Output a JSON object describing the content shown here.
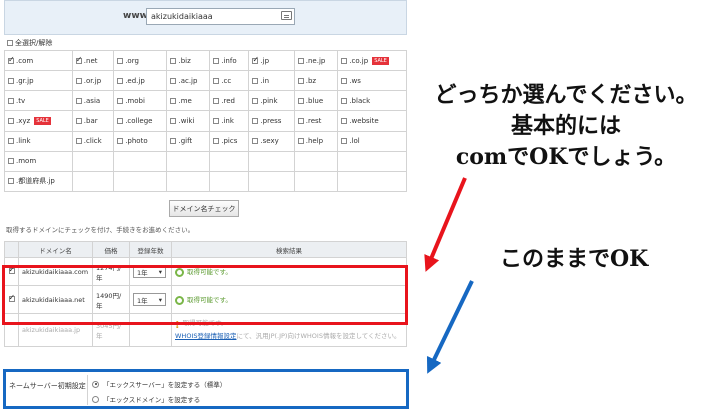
{
  "domain_search": {
    "prefix": "www.",
    "value": "akizukidaikiaaa",
    "keyboard_icon": "keyboard-icon"
  },
  "select_all_label": "全選択/解除",
  "tld_grid": [
    [
      {
        "label": ".com",
        "checked": true
      },
      {
        "label": ".net",
        "checked": true
      },
      {
        "label": ".org",
        "checked": false
      },
      {
        "label": ".biz",
        "checked": false
      },
      {
        "label": ".info",
        "checked": false
      },
      {
        "label": ".jp",
        "checked": true
      },
      {
        "label": ".ne.jp",
        "checked": false
      },
      {
        "label": ".co.jp",
        "checked": false,
        "sale": "SALE"
      }
    ],
    [
      {
        "label": ".gr.jp",
        "checked": false
      },
      {
        "label": ".or.jp",
        "checked": false
      },
      {
        "label": ".ed.jp",
        "checked": false
      },
      {
        "label": ".ac.jp",
        "checked": false
      },
      {
        "label": ".cc",
        "checked": false
      },
      {
        "label": ".in",
        "checked": false
      },
      {
        "label": ".bz",
        "checked": false
      },
      {
        "label": ".ws",
        "checked": false
      }
    ],
    [
      {
        "label": ".tv",
        "checked": false
      },
      {
        "label": ".asia",
        "checked": false
      },
      {
        "label": ".mobi",
        "checked": false
      },
      {
        "label": ".me",
        "checked": false
      },
      {
        "label": ".red",
        "checked": false
      },
      {
        "label": ".pink",
        "checked": false
      },
      {
        "label": ".blue",
        "checked": false
      },
      {
        "label": ".black",
        "checked": false
      }
    ],
    [
      {
        "label": ".xyz",
        "checked": false,
        "sale": "SALE"
      },
      {
        "label": ".bar",
        "checked": false
      },
      {
        "label": ".college",
        "checked": false
      },
      {
        "label": ".wiki",
        "checked": false
      },
      {
        "label": ".ink",
        "checked": false
      },
      {
        "label": ".press",
        "checked": false
      },
      {
        "label": ".rest",
        "checked": false
      },
      {
        "label": ".website",
        "checked": false
      }
    ],
    [
      {
        "label": ".link",
        "checked": false
      },
      {
        "label": ".click",
        "checked": false
      },
      {
        "label": ".photo",
        "checked": false
      },
      {
        "label": ".gift",
        "checked": false
      },
      {
        "label": ".pics",
        "checked": false
      },
      {
        "label": ".sexy",
        "checked": false
      },
      {
        "label": ".help",
        "checked": false
      },
      {
        "label": ".lol",
        "checked": false
      }
    ],
    [
      {
        "label": ".mom",
        "checked": false
      }
    ],
    [
      {
        "label": ".都道府県.jp",
        "checked": false
      }
    ]
  ],
  "check_button_label": "ドメイン名チェック",
  "instruction": "取得するドメインにチェックを付け、手続きをお進めください。",
  "results": {
    "headers": [
      "ドメイン名",
      "価格",
      "登録年数",
      "検索結果"
    ],
    "rows": [
      {
        "checked": true,
        "domain": "akizukidaikiaaa.com",
        "price": "1274円/年",
        "years": "1年",
        "status": "取得可能です。"
      },
      {
        "checked": true,
        "domain": "akizukidaikiaaa.net",
        "price": "1490円/年",
        "years": "1年",
        "status": "取得可能です。"
      },
      {
        "checked": false,
        "domain": "akizukidaikiaaa.jp",
        "price": "3045円/年",
        "status_line1": "取得可能です。",
        "whois_link": "WHOIS登録情報設定",
        "status_line2": "にて、汎用JP(.JP)向けWHOIS情報を設定してください。"
      }
    ]
  },
  "nameserver": {
    "label": "ネームサーバー初期設定",
    "options": [
      {
        "label": "「エックスサーバー」を設定する（標準）",
        "selected": true
      },
      {
        "label": "「エックスドメイン」を設定する",
        "selected": false
      }
    ]
  },
  "annotations": {
    "main_lines": [
      "どっちか選んでください。",
      "基本的には",
      "comでOKでしょう。"
    ],
    "ok": "このままでOK"
  },
  "colors": {
    "red_highlight": "#e8141c",
    "blue_highlight": "#1668c2",
    "sale_badge": "#e5323a",
    "available_green": "#7ab648"
  }
}
